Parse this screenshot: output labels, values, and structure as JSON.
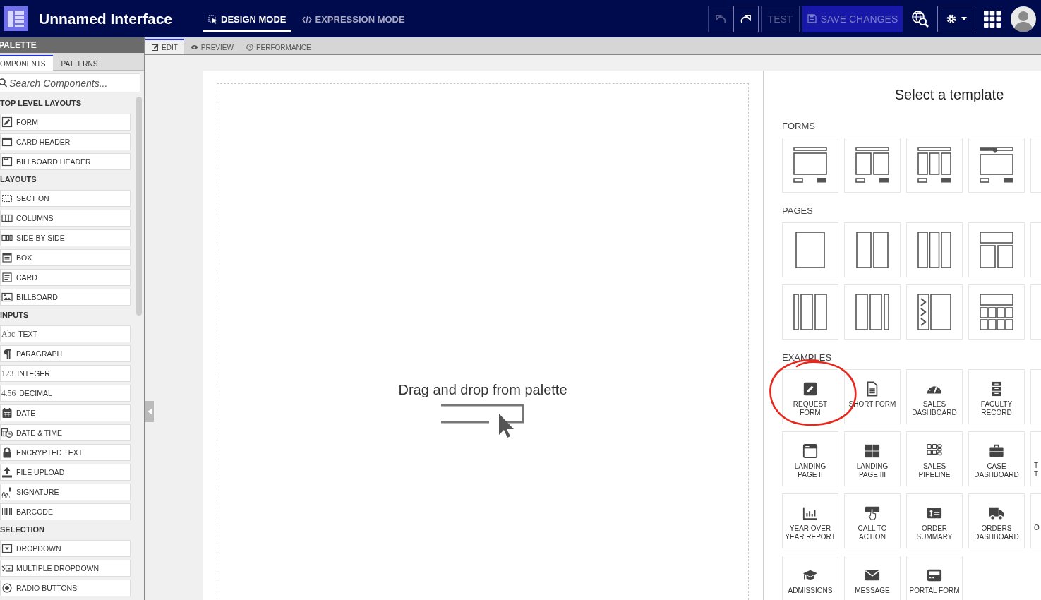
{
  "header": {
    "title": "Unnamed Interface",
    "modes": [
      {
        "label": "DESIGN MODE",
        "selected": true
      },
      {
        "label": "EXPRESSION MODE",
        "selected": false
      }
    ],
    "undo": {
      "disabled": true
    },
    "redo": {
      "disabled": false
    },
    "test": {
      "label": "TEST",
      "disabled": true
    },
    "save": {
      "label": "SAVE CHANGES",
      "disabled": true
    }
  },
  "palette": {
    "title": "PALETTE",
    "tabs": [
      {
        "label": "OMPONENTS",
        "selected": true
      },
      {
        "label": "PATTERNS",
        "selected": false
      }
    ],
    "search": {
      "placeholder": "Search Components..."
    },
    "groups": [
      {
        "heading": "TOP LEVEL LAYOUTS",
        "items": [
          {
            "label": "FORM"
          },
          {
            "label": "CARD HEADER"
          },
          {
            "label": "BILLBOARD HEADER"
          }
        ]
      },
      {
        "heading": "LAYOUTS",
        "items": [
          {
            "label": "SECTION"
          },
          {
            "label": "COLUMNS"
          },
          {
            "label": "SIDE BY SIDE"
          },
          {
            "label": "BOX"
          },
          {
            "label": "CARD"
          },
          {
            "label": "BILLBOARD"
          }
        ]
      },
      {
        "heading": "INPUTS",
        "items": [
          {
            "label": "TEXT",
            "glyph": "Abc"
          },
          {
            "label": "PARAGRAPH"
          },
          {
            "label": "INTEGER",
            "glyph": "123"
          },
          {
            "label": "DECIMAL",
            "glyph": "4.56"
          },
          {
            "label": "DATE"
          },
          {
            "label": "DATE & TIME"
          },
          {
            "label": "ENCRYPTED TEXT"
          },
          {
            "label": "FILE UPLOAD"
          },
          {
            "label": "SIGNATURE"
          },
          {
            "label": "BARCODE"
          }
        ]
      },
      {
        "heading": "SELECTION",
        "items": [
          {
            "label": "DROPDOWN"
          },
          {
            "label": "MULTIPLE DROPDOWN"
          },
          {
            "label": "RADIO BUTTONS"
          }
        ]
      }
    ]
  },
  "editor_tabs": [
    {
      "label": "EDIT",
      "selected": true
    },
    {
      "label": "PREVIEW",
      "selected": false
    },
    {
      "label": "PERFORMANCE",
      "selected": false
    }
  ],
  "canvas": {
    "hint": "Drag and drop from palette"
  },
  "templates": {
    "title": "Select a template",
    "sections": [
      {
        "heading": "FORMS",
        "kind": "layouts"
      },
      {
        "heading": "PAGES",
        "kind": "layouts"
      },
      {
        "heading": "EXAMPLES",
        "kind": "examples",
        "cards": [
          {
            "kind": "full",
            "lines": [
              "REQUEST",
              "FORM"
            ],
            "circled": true
          },
          {
            "kind": "full",
            "lines": [
              "SHORT FORM"
            ],
            "circled": false
          },
          {
            "kind": "full",
            "lines": [
              "SALES",
              "DASHBOARD"
            ],
            "circled": false
          },
          {
            "kind": "full",
            "lines": [
              "FACULTY",
              "RECORD"
            ],
            "circled": false
          },
          {
            "kind": "cut",
            "circled": false
          },
          {
            "kind": "full",
            "lines": [
              "LANDING",
              "PAGE II"
            ],
            "circled": false
          },
          {
            "kind": "full",
            "lines": [
              "LANDING",
              "PAGE III"
            ],
            "circled": false
          },
          {
            "kind": "full",
            "lines": [
              "SALES",
              "PIPELINE"
            ],
            "circled": false
          },
          {
            "kind": "full",
            "lines": [
              "CASE",
              "DASHBOARD"
            ],
            "circled": false
          },
          {
            "kind": "cut",
            "lines": [
              "T",
              "T"
            ],
            "circled": false
          },
          {
            "kind": "full",
            "lines": [
              "YEAR OVER",
              "YEAR REPORT"
            ],
            "circled": false
          },
          {
            "kind": "full",
            "lines": [
              "CALL TO",
              "ACTION"
            ],
            "circled": false
          },
          {
            "kind": "full",
            "lines": [
              "ORDER",
              "SUMMARY"
            ],
            "circled": false
          },
          {
            "kind": "full",
            "lines": [
              "ORDERS",
              "DASHBOARD"
            ],
            "circled": false
          },
          {
            "kind": "cut",
            "lines": [
              "O"
            ],
            "circled": false
          },
          {
            "kind": "full",
            "lines": [
              "ADMISSIONS"
            ],
            "circled": false
          },
          {
            "kind": "full",
            "lines": [
              "MESSAGE"
            ],
            "circled": false
          },
          {
            "kind": "full",
            "lines": [
              "PORTAL FORM"
            ],
            "circled": false
          }
        ]
      }
    ]
  }
}
